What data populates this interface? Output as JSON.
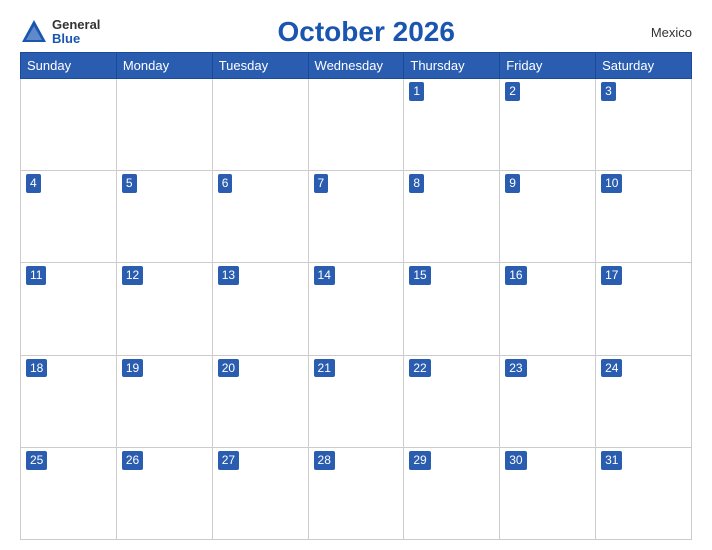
{
  "header": {
    "logo_general": "General",
    "logo_blue": "Blue",
    "title": "October 2026",
    "country": "Mexico"
  },
  "calendar": {
    "days_of_week": [
      "Sunday",
      "Monday",
      "Tuesday",
      "Wednesday",
      "Thursday",
      "Friday",
      "Saturday"
    ],
    "weeks": [
      [
        "",
        "",
        "",
        "",
        "1",
        "2",
        "3"
      ],
      [
        "4",
        "5",
        "6",
        "7",
        "8",
        "9",
        "10"
      ],
      [
        "11",
        "12",
        "13",
        "14",
        "15",
        "16",
        "17"
      ],
      [
        "18",
        "19",
        "20",
        "21",
        "22",
        "23",
        "24"
      ],
      [
        "25",
        "26",
        "27",
        "28",
        "29",
        "30",
        "31"
      ]
    ]
  }
}
